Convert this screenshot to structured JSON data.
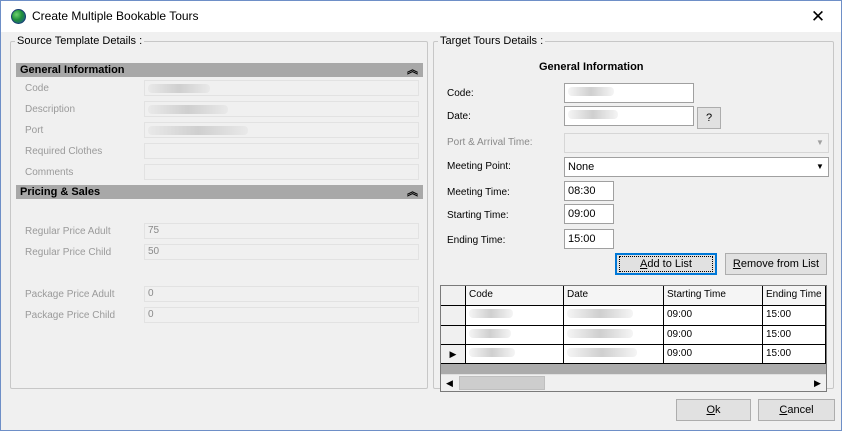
{
  "window": {
    "title": "Create Multiple Bookable Tours"
  },
  "source": {
    "legend": "Source Template Details :",
    "general_header": "General Information",
    "general_fields": [
      {
        "label": "Code",
        "value": ""
      },
      {
        "label": "Description",
        "value": ""
      },
      {
        "label": "Port",
        "value": ""
      },
      {
        "label": "Required Clothes",
        "value": ""
      },
      {
        "label": "Comments",
        "value": ""
      }
    ],
    "pricing_header": "Pricing & Sales",
    "price_fields": [
      {
        "label": "Regular Price Adult",
        "value": "75"
      },
      {
        "label": "Regular Price Child",
        "value": "50"
      },
      {
        "label": "Package Price Adult",
        "value": "0"
      },
      {
        "label": "Package Price Child",
        "value": "0"
      }
    ]
  },
  "target": {
    "legend": "Target Tours Details :",
    "heading": "General Information",
    "code_label": "Code:",
    "code_value": "",
    "date_label": "Date:",
    "date_value": "",
    "date_button": "?",
    "port_label": "Port & Arrival Time:",
    "port_value": "",
    "meeting_point_label": "Meeting Point:",
    "meeting_point_value": "None",
    "meeting_time_label": "Meeting Time:",
    "meeting_time_value": "08:30",
    "starting_time_label": "Starting Time:",
    "starting_time_value": "09:00",
    "ending_time_label": "Ending Time:",
    "ending_time_value": "15:00",
    "add_button": {
      "accel": "A",
      "rest": "dd to List"
    },
    "remove_button": {
      "accel": "R",
      "rest": "emove from List"
    },
    "grid": {
      "columns": [
        "Code",
        "Date",
        "Starting Time",
        "Ending Time"
      ],
      "rows": [
        {
          "code": "",
          "date": "",
          "start": "09:00",
          "end": "15:00",
          "current": false
        },
        {
          "code": "",
          "date": "",
          "start": "09:00",
          "end": "15:00",
          "current": false
        },
        {
          "code": "",
          "date": "",
          "start": "09:00",
          "end": "15:00",
          "current": true
        }
      ]
    }
  },
  "footer": {
    "ok_button": {
      "accel": "O",
      "rest": "k"
    },
    "cancel_button": {
      "accel": "C",
      "rest": "ancel"
    }
  },
  "icons": {
    "app": "globe-icon",
    "close": "close-icon",
    "collapse": "chevron-double-up-icon",
    "dropdown": "chevron-down-icon",
    "current_row": "row-pointer-icon"
  }
}
